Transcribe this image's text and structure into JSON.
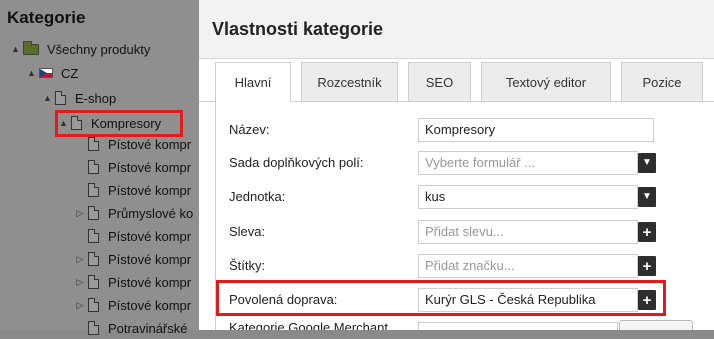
{
  "sidebar": {
    "title": "Kategorie",
    "tree": [
      {
        "label": "Všechny produkty",
        "icon": "folder-icon",
        "arrow": "▲"
      },
      {
        "label": "CZ",
        "icon": "flag-cz-icon",
        "arrow": "▲"
      },
      {
        "label": "E-shop",
        "icon": "page-icon",
        "arrow": "▲"
      },
      {
        "label": "Kompresory",
        "icon": "page-icon",
        "arrow": "▲"
      },
      {
        "label": "Pístové kompr",
        "icon": "page-icon",
        "arrow": ""
      },
      {
        "label": "Pístové kompr",
        "icon": "page-icon",
        "arrow": ""
      },
      {
        "label": "Pístové kompr",
        "icon": "page-icon",
        "arrow": ""
      },
      {
        "label": "Průmyslové ko",
        "icon": "page-icon",
        "arrow": "▷"
      },
      {
        "label": "Pístové kompr",
        "icon": "page-icon",
        "arrow": ""
      },
      {
        "label": "Pístové kompr",
        "icon": "page-icon",
        "arrow": "▷"
      },
      {
        "label": "Pístové kompr",
        "icon": "page-icon",
        "arrow": "▷"
      },
      {
        "label": "Pístové kompr",
        "icon": "page-icon",
        "arrow": "▷"
      },
      {
        "label": "Potravinářské",
        "icon": "page-icon",
        "arrow": ""
      }
    ]
  },
  "modal": {
    "title": "Vlastnosti kategorie",
    "tabs": [
      "Hlavní",
      "Rozcestník",
      "SEO",
      "Textový editor",
      "Pozice"
    ],
    "active_tab": "Hlavní",
    "fields": {
      "name": {
        "label": "Název:",
        "value": "Kompresory"
      },
      "field_set": {
        "label": "Sada doplňkových polí:",
        "placeholder": "Vyberte formulář ..."
      },
      "unit": {
        "label": "Jednotka:",
        "value": "kus"
      },
      "discount": {
        "label": "Sleva:",
        "placeholder": "Přidat slevu..."
      },
      "tags": {
        "label": "Štítky:",
        "placeholder": "Přidat značku..."
      },
      "shipping": {
        "label": "Povolená doprava:",
        "value": "Kurýr GLS - Česká Republika"
      }
    },
    "cut_label": "Kategorie Google Merchant"
  },
  "colors": {
    "highlight": "#e21c1c",
    "overlay": "#8f8f8f",
    "button": "#2e2e2e"
  }
}
